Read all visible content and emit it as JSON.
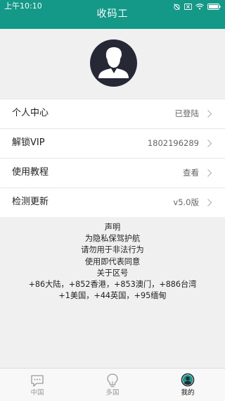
{
  "status_bar": {
    "time": "上午10:10"
  },
  "app": {
    "title": "收码工"
  },
  "colors": {
    "accent": "#149988",
    "avatar_bg": "#262835",
    "background": "#f0f0f0"
  },
  "menu": {
    "items": [
      {
        "label": "个人中心",
        "value": "已登陆",
        "icon": "chevron-right-icon"
      },
      {
        "label": "解锁VIP",
        "value": "1802196289",
        "icon": "chevron-right-icon"
      },
      {
        "label": "使用教程",
        "value": "查看",
        "icon": "chevron-right-icon"
      },
      {
        "label": "检测更新",
        "value": "v5.0版",
        "icon": "chevron-right-icon"
      }
    ]
  },
  "notice": {
    "lines": [
      "声明",
      "为隐私保驾护航",
      "请勿用于非法行为",
      "使用即代表同意",
      "关于区号",
      "+86大陆，+852香港，+853澳门，+886台湾",
      "+1美国，+44英国，+95缅甸"
    ]
  },
  "tabs": [
    {
      "label": "中国",
      "icon": "chat-icon",
      "active": false
    },
    {
      "label": "多国",
      "icon": "lightbulb-icon",
      "active": false
    },
    {
      "label": "我的",
      "icon": "profile-icon",
      "active": true
    }
  ]
}
